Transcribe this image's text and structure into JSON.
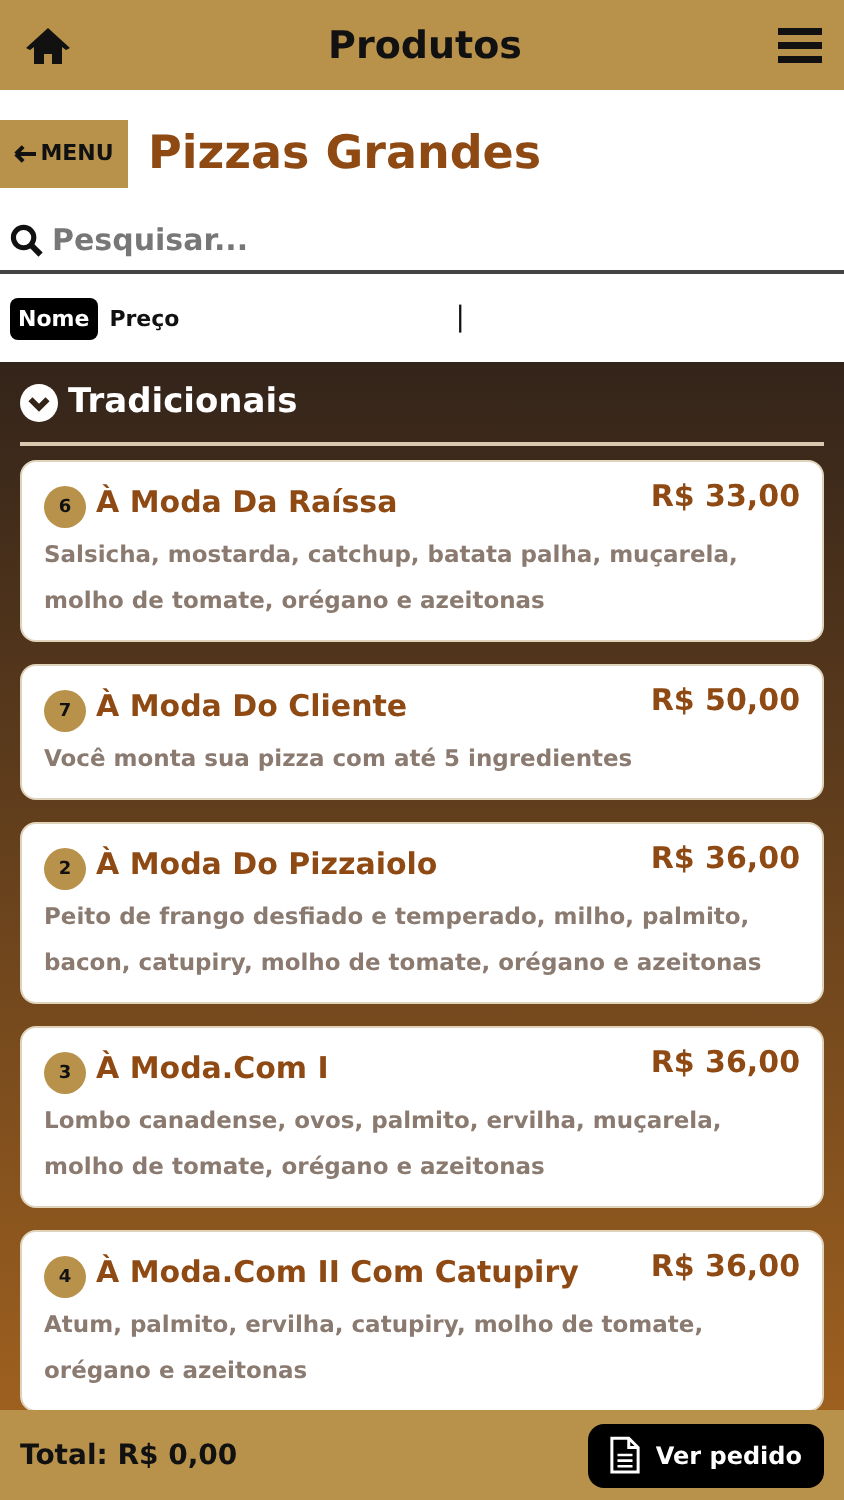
{
  "header": {
    "title": "Produtos"
  },
  "back_button": {
    "label": "MENU"
  },
  "page_title": "Pizzas Grandes",
  "search": {
    "placeholder": "Pesquisar..."
  },
  "sort_tabs": [
    {
      "label": "Nome",
      "selected": true
    },
    {
      "label": "Preço",
      "selected": false
    }
  ],
  "sort_separator": "|",
  "category": {
    "title": "Tradicionais",
    "expanded": true
  },
  "products": [
    {
      "number": "6",
      "name": "À Moda Da Raíssa",
      "price": "R$ 33,00",
      "description": "Salsicha, mostarda, catchup, batata palha, muçarela, molho de tomate, orégano e azeitonas"
    },
    {
      "number": "7",
      "name": "À Moda Do Cliente",
      "price": "R$ 50,00",
      "description": "Você monta sua pizza com até 5 ingredientes"
    },
    {
      "number": "2",
      "name": "À Moda Do Pizzaiolo",
      "price": "R$ 36,00",
      "description": "Peito de frango desfiado e temperado, milho, palmito, bacon, catupiry, molho de tomate, orégano e azeitonas"
    },
    {
      "number": "3",
      "name": "À Moda.Com I",
      "price": "R$ 36,00",
      "description": "Lombo canadense, ovos, palmito, ervilha, muçarela, molho de tomate, orégano e azeitonas"
    },
    {
      "number": "4",
      "name": "À Moda.Com II Com Catupiry",
      "price": "R$ 36,00",
      "description": "Atum, palmito, ervilha, catupiry, molho de tomate, orégano e azeitonas"
    }
  ],
  "footer": {
    "total": "Total: R$ 0,00",
    "order_button": "Ver pedido"
  }
}
